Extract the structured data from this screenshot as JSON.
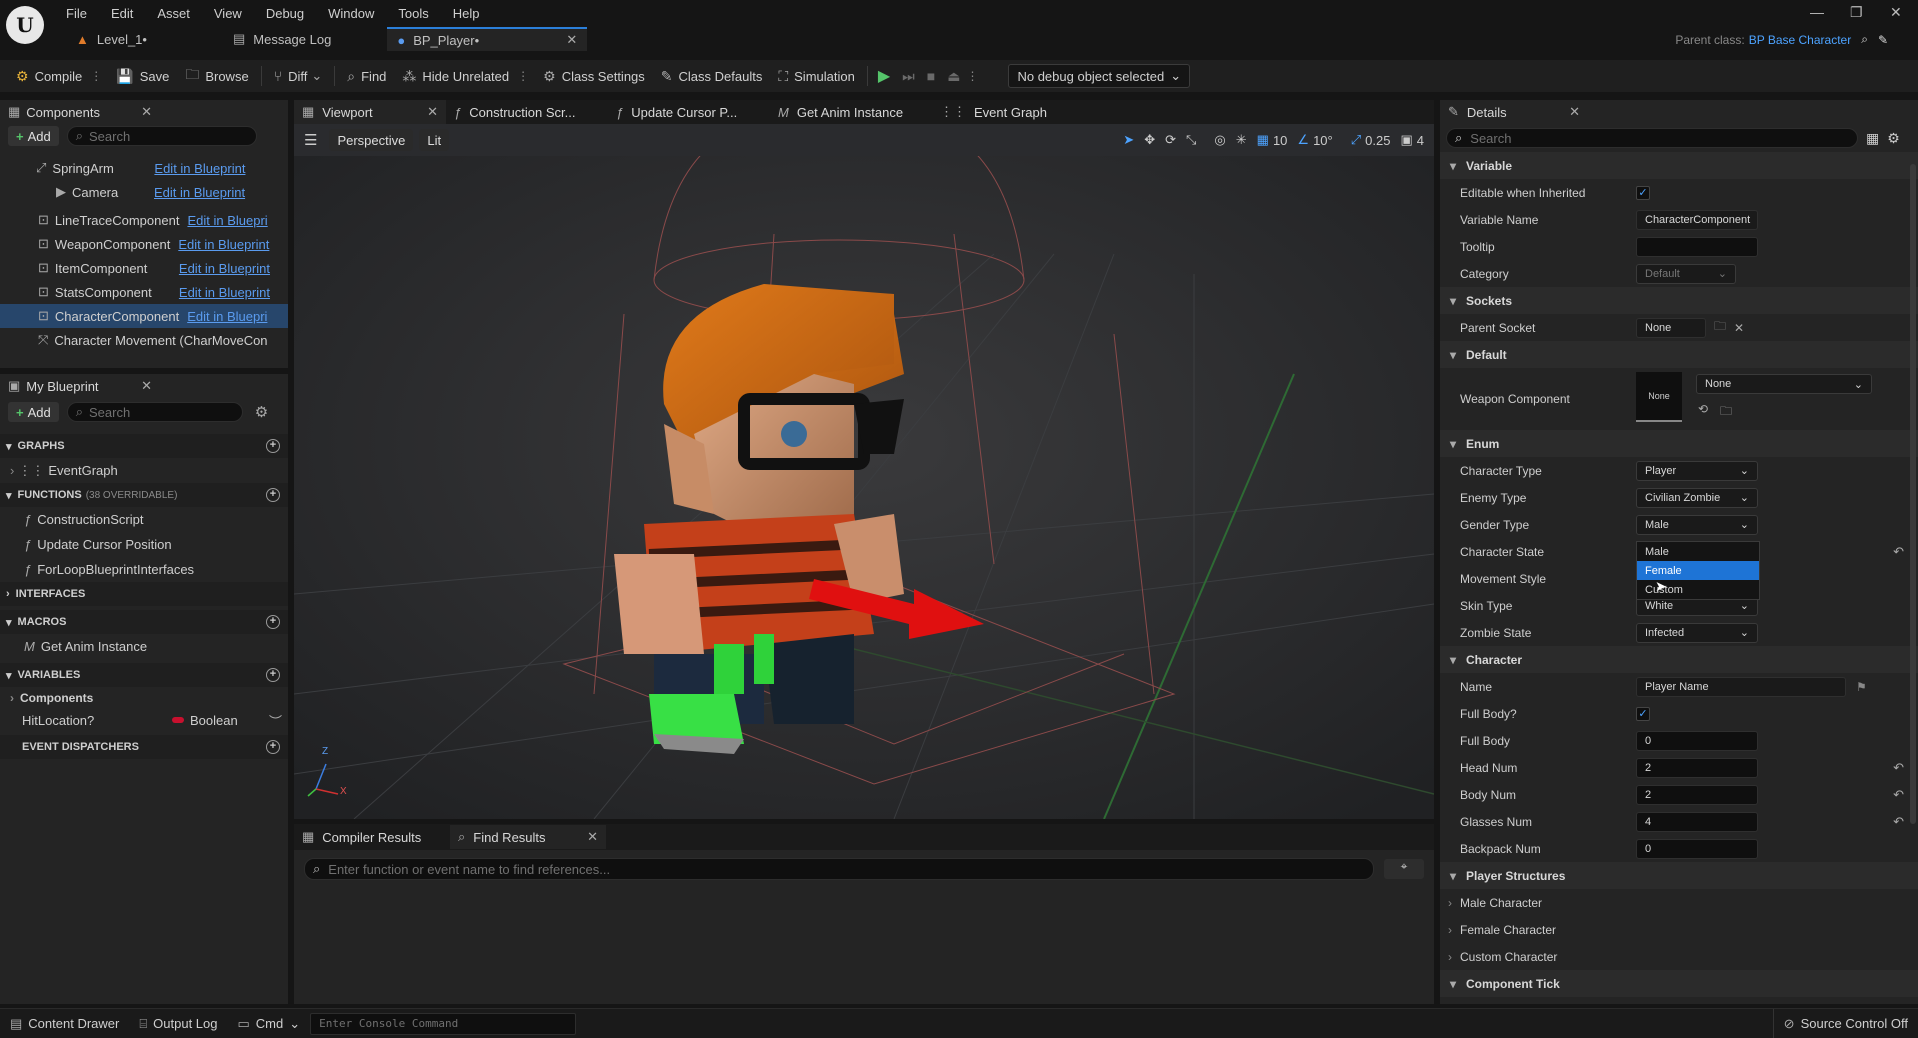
{
  "logo_text": "U",
  "menu": [
    "File",
    "Edit",
    "Asset",
    "View",
    "Debug",
    "Window",
    "Tools",
    "Help"
  ],
  "doc_tabs": [
    {
      "label": "Level_1•"
    },
    {
      "label": "Message Log"
    },
    {
      "label": "BP_Player•"
    }
  ],
  "parent_class": {
    "label": "Parent class:",
    "value": "BP Base Character"
  },
  "toolbar": {
    "compile": "Compile",
    "save": "Save",
    "browse": "Browse",
    "diff": "Diff",
    "find": "Find",
    "hide_unrelated": "Hide Unrelated",
    "class_settings": "Class Settings",
    "class_defaults": "Class Defaults",
    "simulation": "Simulation",
    "debug_object": "No debug object selected"
  },
  "components_panel": {
    "tab": "Components",
    "add": "Add",
    "search_placeholder": "Search",
    "items": [
      {
        "name": "SpringArm",
        "edit": "Edit in Blueprint"
      },
      {
        "name": "Camera",
        "edit": "Edit in Blueprint"
      },
      {
        "name": "LineTraceComponent",
        "edit": "Edit in Bluepri"
      },
      {
        "name": "WeaponComponent",
        "edit": "Edit in Blueprint"
      },
      {
        "name": "ItemComponent",
        "edit": "Edit in Blueprint"
      },
      {
        "name": "StatsComponent",
        "edit": "Edit in Blueprint"
      },
      {
        "name": "CharacterComponent",
        "edit": "Edit in Bluepri"
      },
      {
        "name": "Character Movement (CharMoveCon",
        "edit": ""
      }
    ]
  },
  "my_blueprint": {
    "tab": "My Blueprint",
    "add": "Add",
    "search_placeholder": "Search",
    "graphs_label": "GRAPHS",
    "graphs": [
      "EventGraph"
    ],
    "functions_label": "FUNCTIONS",
    "functions_note": "(38 OVERRIDABLE)",
    "functions": [
      "ConstructionScript",
      "Update Cursor Position",
      "ForLoopBlueprintInterfaces"
    ],
    "interfaces_label": "INTERFACES",
    "macros_label": "MACROS",
    "macros": [
      "Get Anim Instance"
    ],
    "variables_label": "VARIABLES",
    "variables_group": "Components",
    "variables": [
      {
        "name": "HitLocation?",
        "type": "Boolean"
      }
    ],
    "dispatchers_label": "EVENT DISPATCHERS"
  },
  "editor_tabs": [
    "Viewport",
    "Construction Scr...",
    "Update Cursor P...",
    "Get Anim Instance",
    "Event Graph"
  ],
  "viewport": {
    "perspective": "Perspective",
    "lit": "Lit",
    "grid_snap": "10",
    "rot_snap": "10°",
    "scale_snap": "0.25",
    "cam_speed": "4",
    "axis_x": "X",
    "axis_z": "Z"
  },
  "bottom_tabs": {
    "compiler": "Compiler Results",
    "find": "Find Results",
    "find_placeholder": "Enter function or event name to find references..."
  },
  "details": {
    "tab": "Details",
    "search_placeholder": "Search",
    "sections": {
      "variable": "Variable",
      "sockets": "Sockets",
      "default": "Default",
      "enum": "Enum",
      "character": "Character",
      "player_structures": "Player Structures",
      "component_tick": "Component Tick"
    },
    "editable_when_inherited": "Editable when Inherited",
    "variable_name_label": "Variable Name",
    "variable_name_value": "CharacterComponent",
    "tooltip_label": "Tooltip",
    "category_label": "Category",
    "category_value": "Default",
    "parent_socket_label": "Parent Socket",
    "parent_socket_value": "None",
    "weapon_component_label": "Weapon Component",
    "weapon_thumb": "None",
    "weapon_value": "None",
    "enum_rows": [
      {
        "label": "Character Type",
        "value": "Player"
      },
      {
        "label": "Enemy Type",
        "value": "Civilian Zombie"
      },
      {
        "label": "Gender Type",
        "value": "Male"
      },
      {
        "label": "Character State",
        "value": ""
      },
      {
        "label": "Movement Style",
        "value": ""
      },
      {
        "label": "Skin Type",
        "value": "White"
      },
      {
        "label": "Zombie State",
        "value": "Infected"
      }
    ],
    "gender_options": [
      "Male",
      "Female",
      "Custom"
    ],
    "gender_highlight": "Female",
    "char_name_label": "Name",
    "char_name_value": "Player Name",
    "full_body_q_label": "Full Body?",
    "num_rows": [
      {
        "label": "Full Body",
        "value": "0"
      },
      {
        "label": "Head Num",
        "value": "2"
      },
      {
        "label": "Body Num",
        "value": "2"
      },
      {
        "label": "Glasses Num",
        "value": "4"
      },
      {
        "label": "Backpack Num",
        "value": "0"
      }
    ],
    "structures": [
      "Male Character",
      "Female Character",
      "Custom Character"
    ]
  },
  "statusbar": {
    "content_drawer": "Content Drawer",
    "output_log": "Output Log",
    "cmd": "Cmd",
    "console_placeholder": "Enter Console Command",
    "source_control": "Source Control Off"
  },
  "colors": {
    "accent": "#2b7fd9",
    "selection": "#27466b",
    "dropdown_highlight": "#1e74d6"
  }
}
